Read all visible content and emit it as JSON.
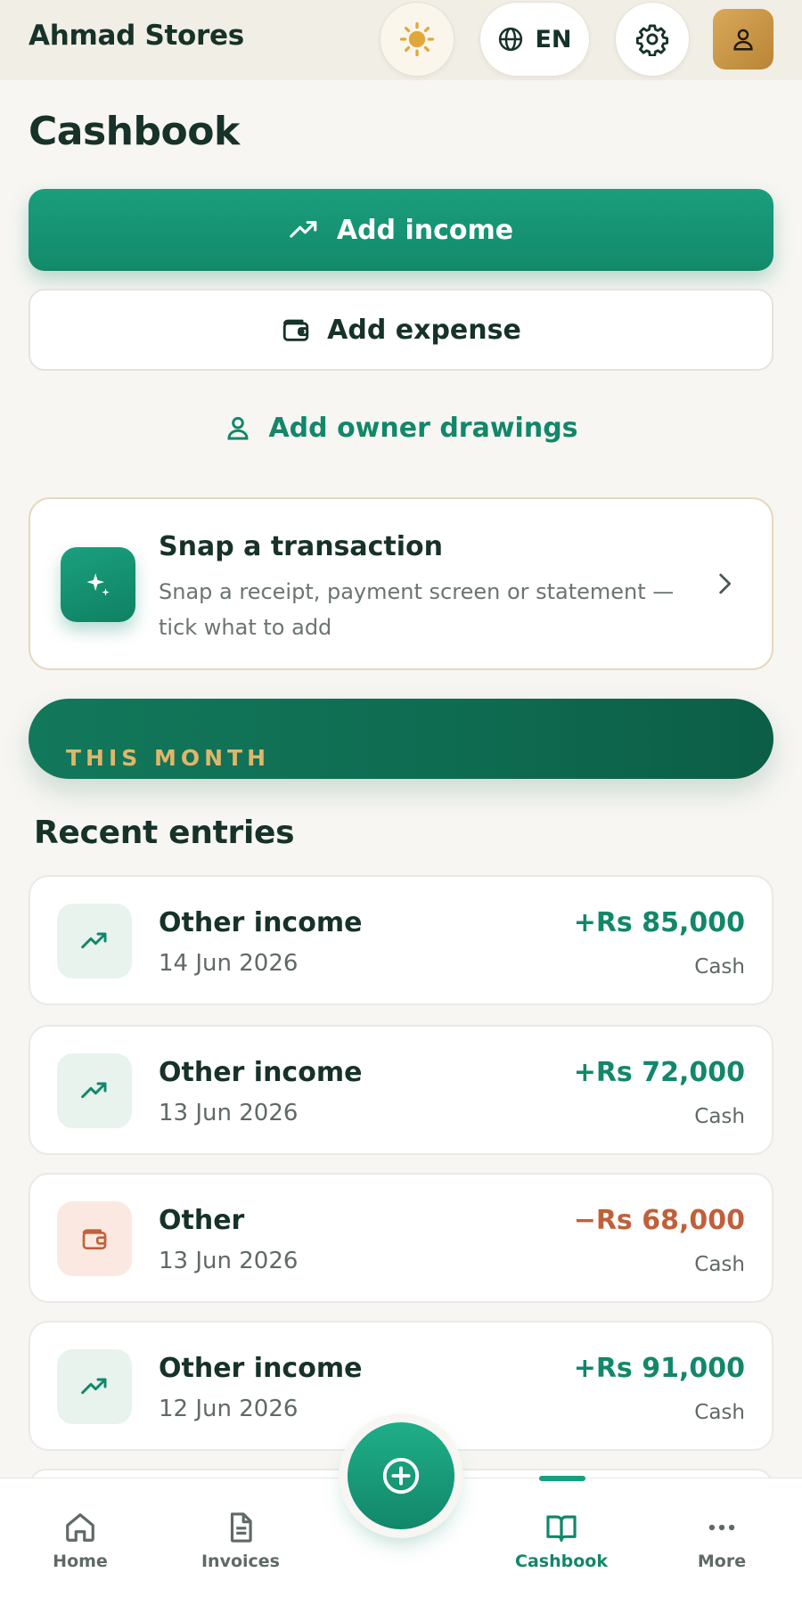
{
  "header": {
    "brand": "Ahmad Stores",
    "language": "EN"
  },
  "page": {
    "title": "Cashbook"
  },
  "actions": {
    "add_income": "Add income",
    "add_expense": "Add expense",
    "add_drawings": "Add owner drawings"
  },
  "snap": {
    "title": "Snap a transaction",
    "description": "Snap a receipt, payment screen or statement — tick what to add"
  },
  "month_banner": {
    "label": "THIS MONTH"
  },
  "recent": {
    "title": "Recent entries",
    "entries": [
      {
        "name": "Other income",
        "date": "14 Jun 2026",
        "amount": "+Rs 85,000",
        "method": "Cash",
        "type": "income"
      },
      {
        "name": "Other income",
        "date": "13 Jun 2026",
        "amount": "+Rs 72,000",
        "method": "Cash",
        "type": "income"
      },
      {
        "name": "Other",
        "date": "13 Jun 2026",
        "amount": "−Rs 68,000",
        "method": "Cash",
        "type": "expense"
      },
      {
        "name": "Other income",
        "date": "12 Jun 2026",
        "amount": "+Rs 91,000",
        "method": "Cash",
        "type": "income"
      }
    ]
  },
  "nav": {
    "items": [
      {
        "label": "Home",
        "icon": "home-icon"
      },
      {
        "label": "Invoices",
        "icon": "document-icon"
      },
      {
        "label": "Cashbook",
        "icon": "book-icon",
        "active": true
      },
      {
        "label": "More",
        "icon": "more-icon"
      }
    ]
  },
  "colors": {
    "brand_green": "#12876a",
    "expense_red": "#c0603b",
    "gold": "#e0b66a"
  }
}
